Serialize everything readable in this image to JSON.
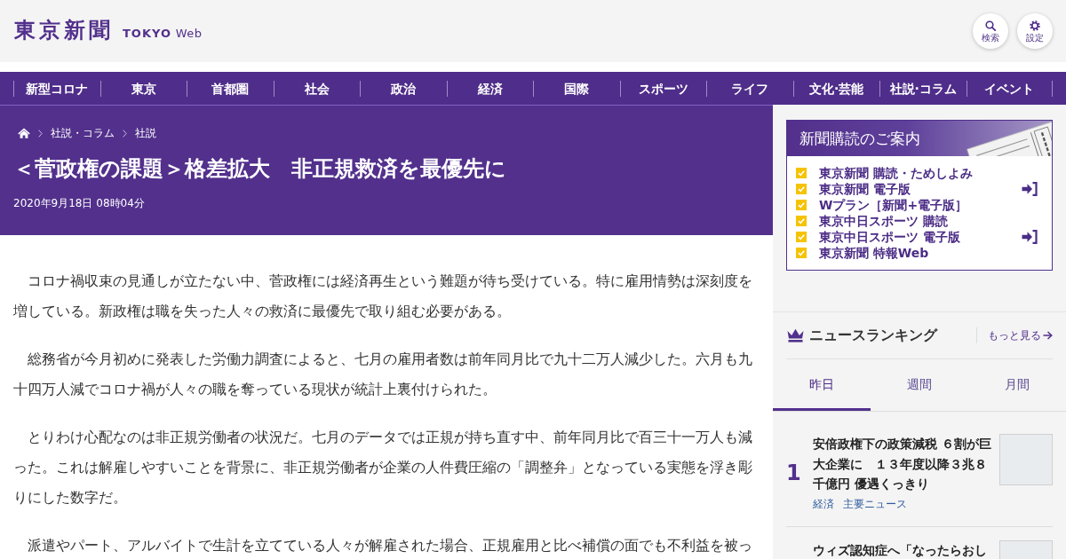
{
  "header": {
    "logo": "東京新聞",
    "logo_sub": "**TOKYO** Web",
    "buttons": [
      {
        "kind": "search",
        "label": "検索"
      },
      {
        "kind": "settings",
        "label": "設定"
      }
    ]
  },
  "nav": [
    "新型コロナ",
    "東京",
    "首都圏",
    "社会",
    "政治",
    "経済",
    "国際",
    "スポーツ",
    "ライフ",
    "文化·芸能",
    "社説·コラム",
    "イベント"
  ],
  "article": {
    "breadcrumb": [
      "社説・コラム",
      "社説"
    ],
    "title": "＜菅政権の課題＞格差拡大　非正規救済を最優先に",
    "date": "2020年9月18日 08時04分",
    "paragraphs": [
      "　コロナ禍収束の見通しが立たない中、菅政権には経済再生という難題が待ち受けている。特に雇用情勢は深刻度を増している。新政権は職を失った人々の救済に最優先で取り組む必要がある。",
      "　総務省が今月初めに発表した労働力調査によると、七月の雇用者数は前年同月比で九十二万人減少した。六月も九十四万人減でコロナ禍が人々の職を奪っている現状が統計上裏付けられた。",
      "　とりわけ心配なのは非正規労働者の状況だ。七月のデータでは正規が持ち直す中、前年同月比で百三十一万人も減った。これは解雇しやすいことを背景に、非正規労働者が企業の人件費圧縮の「調整弁」となっている実態を浮き彫りにした数字だ。",
      "　派遣やパート、アルバイトで生計を立てている人々が解雇された場合、正規雇用と比べ補償の面でも不利益を被っ"
    ]
  },
  "sidebar": {
    "subscribe": {
      "title": "新聞購読のご案内",
      "items": [
        {
          "label": "東京新聞 購読・ためしよみ",
          "login_icon": false
        },
        {
          "label": "東京新聞 電子版",
          "login_icon": true
        },
        {
          "label": "Wプラン［新聞+電子版］",
          "login_icon": false
        },
        {
          "label": "東京中日スポーツ 購読",
          "login_icon": false
        },
        {
          "label": "東京中日スポーツ 電子版",
          "login_icon": true
        },
        {
          "label": "東京新聞 特報Web",
          "login_icon": false
        }
      ]
    },
    "ranking": {
      "title": "ニュースランキング",
      "more": "もっと見る",
      "tabs": [
        {
          "label": "昨日",
          "selected": true
        },
        {
          "label": "週間",
          "selected": false
        },
        {
          "label": "月間",
          "selected": false
        }
      ],
      "items": [
        {
          "rank": "1",
          "title": "安倍政権下の政策減税 ６割が巨大企業に　１３年度以降３兆８千億円 優遇くっきり",
          "tags": [
            "経済",
            "主要ニュース"
          ]
        },
        {
          "title": "ウィズ認知症へ「なったらおし"
        }
      ]
    }
  }
}
